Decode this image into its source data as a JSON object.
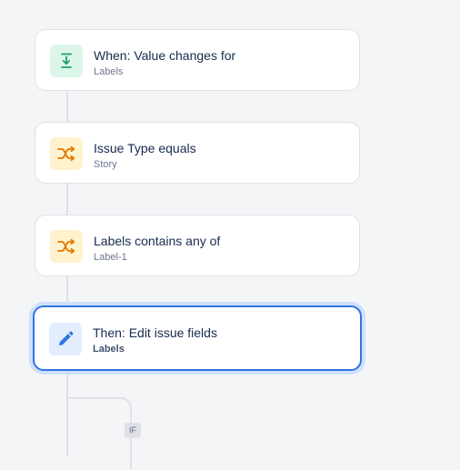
{
  "flow": {
    "nodes": [
      {
        "title": "When: Value changes for",
        "subtitle": "Labels",
        "icon": "download-arrow-icon",
        "accent": "#1f9e6a"
      },
      {
        "title": "Issue Type equals",
        "subtitle": "Story",
        "icon": "shuffle-icon",
        "accent": "#e07a00"
      },
      {
        "title": "Labels contains any of",
        "subtitle": "Label-1",
        "icon": "shuffle-icon",
        "accent": "#e07a00"
      },
      {
        "title": "Then: Edit issue fields",
        "subtitle": "Labels",
        "icon": "pencil-icon",
        "accent": "#2f74e3",
        "selected": true
      }
    ],
    "branch_label": "IF"
  }
}
